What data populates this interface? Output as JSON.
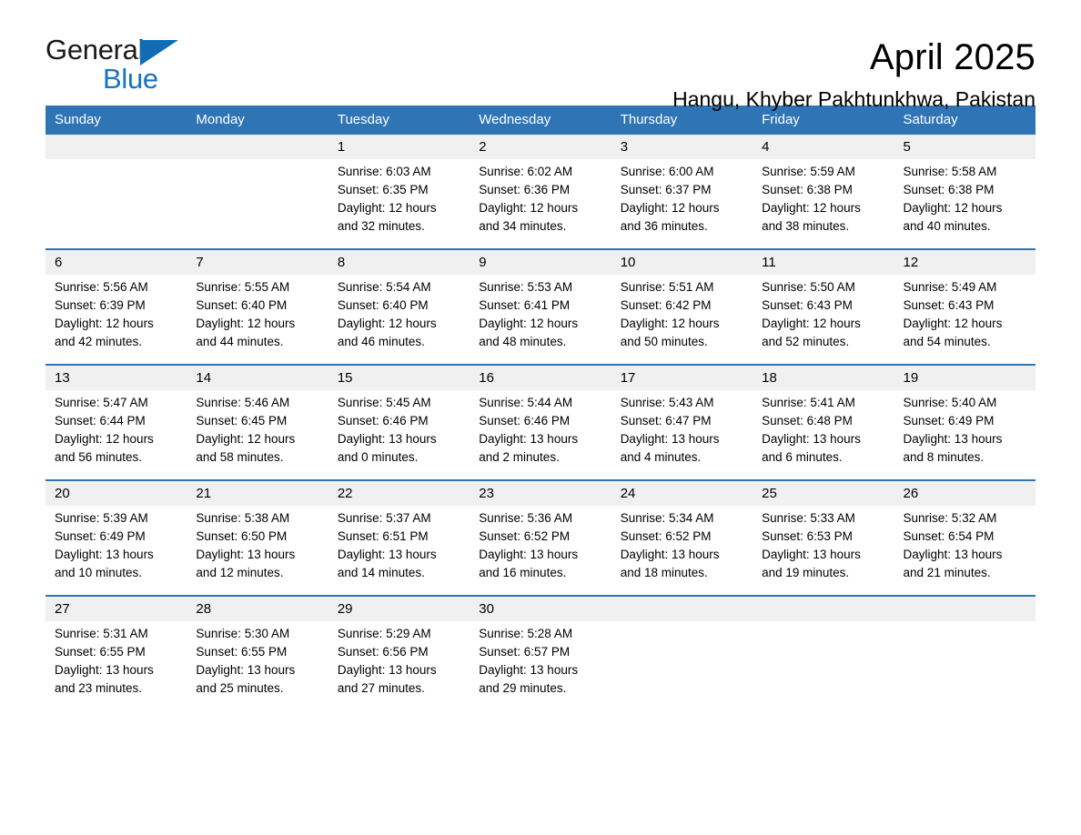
{
  "brand": {
    "name_top": "General",
    "name_bottom": "Blue",
    "triangle_color": "#0f6cb5",
    "blue_text_color": "#1673bd"
  },
  "header": {
    "title": "April 2025",
    "subtitle": "Hangu, Khyber Pakhtunkhwa, Pakistan"
  },
  "theme": {
    "header_bg": "#2f75b5",
    "daynum_bg": "#f0f0f0",
    "rule_color": "#2f75b5"
  },
  "weekday_headers": [
    "Sunday",
    "Monday",
    "Tuesday",
    "Wednesday",
    "Thursday",
    "Friday",
    "Saturday"
  ],
  "weeks": [
    [
      {
        "day": "",
        "empty": true,
        "sunrise": "",
        "sunset": "",
        "daylight_line1": "",
        "daylight_line2": ""
      },
      {
        "day": "",
        "empty": true,
        "sunrise": "",
        "sunset": "",
        "daylight_line1": "",
        "daylight_line2": ""
      },
      {
        "day": "1",
        "empty": false,
        "sunrise": "Sunrise: 6:03 AM",
        "sunset": "Sunset: 6:35 PM",
        "daylight_line1": "Daylight: 12 hours",
        "daylight_line2": "and 32 minutes."
      },
      {
        "day": "2",
        "empty": false,
        "sunrise": "Sunrise: 6:02 AM",
        "sunset": "Sunset: 6:36 PM",
        "daylight_line1": "Daylight: 12 hours",
        "daylight_line2": "and 34 minutes."
      },
      {
        "day": "3",
        "empty": false,
        "sunrise": "Sunrise: 6:00 AM",
        "sunset": "Sunset: 6:37 PM",
        "daylight_line1": "Daylight: 12 hours",
        "daylight_line2": "and 36 minutes."
      },
      {
        "day": "4",
        "empty": false,
        "sunrise": "Sunrise: 5:59 AM",
        "sunset": "Sunset: 6:38 PM",
        "daylight_line1": "Daylight: 12 hours",
        "daylight_line2": "and 38 minutes."
      },
      {
        "day": "5",
        "empty": false,
        "sunrise": "Sunrise: 5:58 AM",
        "sunset": "Sunset: 6:38 PM",
        "daylight_line1": "Daylight: 12 hours",
        "daylight_line2": "and 40 minutes."
      }
    ],
    [
      {
        "day": "6",
        "empty": false,
        "sunrise": "Sunrise: 5:56 AM",
        "sunset": "Sunset: 6:39 PM",
        "daylight_line1": "Daylight: 12 hours",
        "daylight_line2": "and 42 minutes."
      },
      {
        "day": "7",
        "empty": false,
        "sunrise": "Sunrise: 5:55 AM",
        "sunset": "Sunset: 6:40 PM",
        "daylight_line1": "Daylight: 12 hours",
        "daylight_line2": "and 44 minutes."
      },
      {
        "day": "8",
        "empty": false,
        "sunrise": "Sunrise: 5:54 AM",
        "sunset": "Sunset: 6:40 PM",
        "daylight_line1": "Daylight: 12 hours",
        "daylight_line2": "and 46 minutes."
      },
      {
        "day": "9",
        "empty": false,
        "sunrise": "Sunrise: 5:53 AM",
        "sunset": "Sunset: 6:41 PM",
        "daylight_line1": "Daylight: 12 hours",
        "daylight_line2": "and 48 minutes."
      },
      {
        "day": "10",
        "empty": false,
        "sunrise": "Sunrise: 5:51 AM",
        "sunset": "Sunset: 6:42 PM",
        "daylight_line1": "Daylight: 12 hours",
        "daylight_line2": "and 50 minutes."
      },
      {
        "day": "11",
        "empty": false,
        "sunrise": "Sunrise: 5:50 AM",
        "sunset": "Sunset: 6:43 PM",
        "daylight_line1": "Daylight: 12 hours",
        "daylight_line2": "and 52 minutes."
      },
      {
        "day": "12",
        "empty": false,
        "sunrise": "Sunrise: 5:49 AM",
        "sunset": "Sunset: 6:43 PM",
        "daylight_line1": "Daylight: 12 hours",
        "daylight_line2": "and 54 minutes."
      }
    ],
    [
      {
        "day": "13",
        "empty": false,
        "sunrise": "Sunrise: 5:47 AM",
        "sunset": "Sunset: 6:44 PM",
        "daylight_line1": "Daylight: 12 hours",
        "daylight_line2": "and 56 minutes."
      },
      {
        "day": "14",
        "empty": false,
        "sunrise": "Sunrise: 5:46 AM",
        "sunset": "Sunset: 6:45 PM",
        "daylight_line1": "Daylight: 12 hours",
        "daylight_line2": "and 58 minutes."
      },
      {
        "day": "15",
        "empty": false,
        "sunrise": "Sunrise: 5:45 AM",
        "sunset": "Sunset: 6:46 PM",
        "daylight_line1": "Daylight: 13 hours",
        "daylight_line2": "and 0 minutes."
      },
      {
        "day": "16",
        "empty": false,
        "sunrise": "Sunrise: 5:44 AM",
        "sunset": "Sunset: 6:46 PM",
        "daylight_line1": "Daylight: 13 hours",
        "daylight_line2": "and 2 minutes."
      },
      {
        "day": "17",
        "empty": false,
        "sunrise": "Sunrise: 5:43 AM",
        "sunset": "Sunset: 6:47 PM",
        "daylight_line1": "Daylight: 13 hours",
        "daylight_line2": "and 4 minutes."
      },
      {
        "day": "18",
        "empty": false,
        "sunrise": "Sunrise: 5:41 AM",
        "sunset": "Sunset: 6:48 PM",
        "daylight_line1": "Daylight: 13 hours",
        "daylight_line2": "and 6 minutes."
      },
      {
        "day": "19",
        "empty": false,
        "sunrise": "Sunrise: 5:40 AM",
        "sunset": "Sunset: 6:49 PM",
        "daylight_line1": "Daylight: 13 hours",
        "daylight_line2": "and 8 minutes."
      }
    ],
    [
      {
        "day": "20",
        "empty": false,
        "sunrise": "Sunrise: 5:39 AM",
        "sunset": "Sunset: 6:49 PM",
        "daylight_line1": "Daylight: 13 hours",
        "daylight_line2": "and 10 minutes."
      },
      {
        "day": "21",
        "empty": false,
        "sunrise": "Sunrise: 5:38 AM",
        "sunset": "Sunset: 6:50 PM",
        "daylight_line1": "Daylight: 13 hours",
        "daylight_line2": "and 12 minutes."
      },
      {
        "day": "22",
        "empty": false,
        "sunrise": "Sunrise: 5:37 AM",
        "sunset": "Sunset: 6:51 PM",
        "daylight_line1": "Daylight: 13 hours",
        "daylight_line2": "and 14 minutes."
      },
      {
        "day": "23",
        "empty": false,
        "sunrise": "Sunrise: 5:36 AM",
        "sunset": "Sunset: 6:52 PM",
        "daylight_line1": "Daylight: 13 hours",
        "daylight_line2": "and 16 minutes."
      },
      {
        "day": "24",
        "empty": false,
        "sunrise": "Sunrise: 5:34 AM",
        "sunset": "Sunset: 6:52 PM",
        "daylight_line1": "Daylight: 13 hours",
        "daylight_line2": "and 18 minutes."
      },
      {
        "day": "25",
        "empty": false,
        "sunrise": "Sunrise: 5:33 AM",
        "sunset": "Sunset: 6:53 PM",
        "daylight_line1": "Daylight: 13 hours",
        "daylight_line2": "and 19 minutes."
      },
      {
        "day": "26",
        "empty": false,
        "sunrise": "Sunrise: 5:32 AM",
        "sunset": "Sunset: 6:54 PM",
        "daylight_line1": "Daylight: 13 hours",
        "daylight_line2": "and 21 minutes."
      }
    ],
    [
      {
        "day": "27",
        "empty": false,
        "sunrise": "Sunrise: 5:31 AM",
        "sunset": "Sunset: 6:55 PM",
        "daylight_line1": "Daylight: 13 hours",
        "daylight_line2": "and 23 minutes."
      },
      {
        "day": "28",
        "empty": false,
        "sunrise": "Sunrise: 5:30 AM",
        "sunset": "Sunset: 6:55 PM",
        "daylight_line1": "Daylight: 13 hours",
        "daylight_line2": "and 25 minutes."
      },
      {
        "day": "29",
        "empty": false,
        "sunrise": "Sunrise: 5:29 AM",
        "sunset": "Sunset: 6:56 PM",
        "daylight_line1": "Daylight: 13 hours",
        "daylight_line2": "and 27 minutes."
      },
      {
        "day": "30",
        "empty": false,
        "sunrise": "Sunrise: 5:28 AM",
        "sunset": "Sunset: 6:57 PM",
        "daylight_line1": "Daylight: 13 hours",
        "daylight_line2": "and 29 minutes."
      },
      {
        "day": "",
        "empty": true,
        "sunrise": "",
        "sunset": "",
        "daylight_line1": "",
        "daylight_line2": ""
      },
      {
        "day": "",
        "empty": true,
        "sunrise": "",
        "sunset": "",
        "daylight_line1": "",
        "daylight_line2": ""
      },
      {
        "day": "",
        "empty": true,
        "sunrise": "",
        "sunset": "",
        "daylight_line1": "",
        "daylight_line2": ""
      }
    ]
  ]
}
